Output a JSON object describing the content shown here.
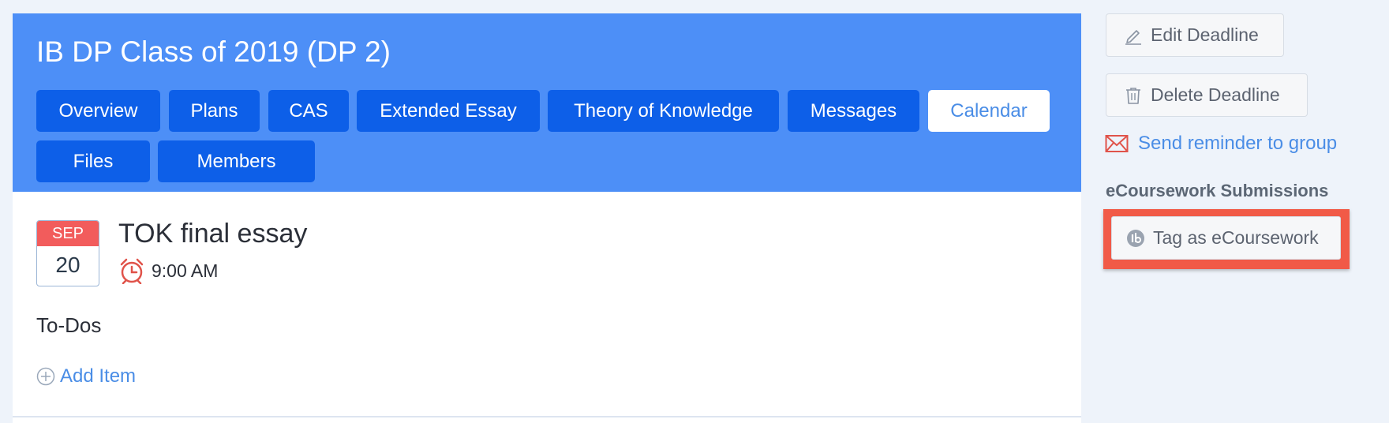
{
  "header": {
    "title": "IB DP Class of 2019 (DP 2)",
    "tabs": [
      {
        "label": "Overview",
        "active": false
      },
      {
        "label": "Plans",
        "active": false
      },
      {
        "label": "CAS",
        "active": false
      },
      {
        "label": "Extended Essay",
        "active": false
      },
      {
        "label": "Theory of Knowledge",
        "active": false
      },
      {
        "label": "Messages",
        "active": false
      },
      {
        "label": "Calendar",
        "active": true
      },
      {
        "label": "Files",
        "active": false
      },
      {
        "label": "Members",
        "active": false
      }
    ]
  },
  "event": {
    "month": "SEP",
    "day": "20",
    "title": "TOK final essay",
    "time": "9:00 AM"
  },
  "todos": {
    "label": "To-Dos",
    "add_item": "Add Item"
  },
  "sidebar": {
    "edit_deadline": "Edit Deadline",
    "delete_deadline": "Delete Deadline",
    "send_reminder": "Send reminder to group",
    "ecoursework_heading": "eCoursework Submissions",
    "tag_ecoursework": "Tag as eCoursework"
  },
  "icons": {
    "alarm": "alarm-clock-icon",
    "add": "plus-circle-icon",
    "edit": "pencil-icon",
    "delete": "trash-icon",
    "mail": "envelope-icon",
    "ib": "ib-logo-icon"
  },
  "colors": {
    "header_bg": "#4d8ff7",
    "tab_bg": "#0d5fe8",
    "link": "#4a8de6",
    "date_month_bg": "#f25c5c",
    "highlight": "#f15a47"
  }
}
